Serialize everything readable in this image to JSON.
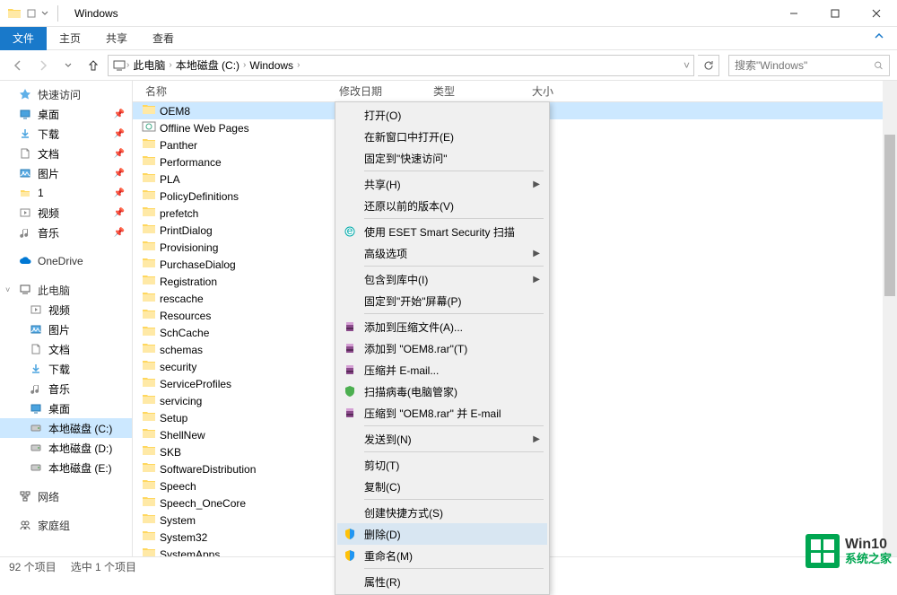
{
  "window": {
    "title": "Windows"
  },
  "ribbon": {
    "file": "文件",
    "home": "主页",
    "share": "共享",
    "view": "查看"
  },
  "breadcrumb": {
    "items": [
      "此电脑",
      "本地磁盘 (C:)",
      "Windows"
    ]
  },
  "search": {
    "placeholder": "搜索\"Windows\""
  },
  "sidebar": {
    "quick_access": "快速访问",
    "items1": [
      {
        "label": "桌面",
        "icon": "desktop"
      },
      {
        "label": "下载",
        "icon": "download"
      },
      {
        "label": "文档",
        "icon": "document"
      },
      {
        "label": "图片",
        "icon": "picture"
      },
      {
        "label": "1",
        "icon": "folder"
      },
      {
        "label": "视频",
        "icon": "video"
      },
      {
        "label": "音乐",
        "icon": "music"
      }
    ],
    "onedrive": "OneDrive",
    "this_pc": "此电脑",
    "items2": [
      {
        "label": "视频",
        "icon": "video"
      },
      {
        "label": "图片",
        "icon": "picture"
      },
      {
        "label": "文档",
        "icon": "document"
      },
      {
        "label": "下载",
        "icon": "download"
      },
      {
        "label": "音乐",
        "icon": "music"
      },
      {
        "label": "桌面",
        "icon": "desktop"
      },
      {
        "label": "本地磁盘 (C:)",
        "icon": "disk",
        "selected": true
      },
      {
        "label": "本地磁盘 (D:)",
        "icon": "disk"
      },
      {
        "label": "本地磁盘 (E:)",
        "icon": "disk"
      }
    ],
    "network": "网络",
    "homegroup": "家庭组"
  },
  "columns": {
    "name": "名称",
    "date": "修改日期",
    "type": "类型",
    "size": "大小"
  },
  "files": [
    {
      "name": "OEM8",
      "selected": true
    },
    {
      "name": "Offline Web Pages",
      "icon": "special"
    },
    {
      "name": "Panther"
    },
    {
      "name": "Performance"
    },
    {
      "name": "PLA"
    },
    {
      "name": "PolicyDefinitions"
    },
    {
      "name": "prefetch"
    },
    {
      "name": "PrintDialog"
    },
    {
      "name": "Provisioning"
    },
    {
      "name": "PurchaseDialog"
    },
    {
      "name": "Registration"
    },
    {
      "name": "rescache"
    },
    {
      "name": "Resources"
    },
    {
      "name": "SchCache"
    },
    {
      "name": "schemas"
    },
    {
      "name": "security"
    },
    {
      "name": "ServiceProfiles"
    },
    {
      "name": "servicing"
    },
    {
      "name": "Setup"
    },
    {
      "name": "ShellNew"
    },
    {
      "name": "SKB"
    },
    {
      "name": "SoftwareDistribution"
    },
    {
      "name": "Speech"
    },
    {
      "name": "Speech_OneCore"
    },
    {
      "name": "System"
    },
    {
      "name": "System32"
    },
    {
      "name": "SystemApps"
    }
  ],
  "context_menu": {
    "items": [
      {
        "label": "打开(O)",
        "type": "item"
      },
      {
        "label": "在新窗口中打开(E)",
        "type": "item"
      },
      {
        "label": "固定到\"快速访问\"",
        "type": "item"
      },
      {
        "type": "sep"
      },
      {
        "label": "共享(H)",
        "type": "submenu"
      },
      {
        "label": "还原以前的版本(V)",
        "type": "item"
      },
      {
        "type": "sep"
      },
      {
        "label": "使用 ESET Smart Security 扫描",
        "type": "item",
        "icon": "eset"
      },
      {
        "label": "高级选项",
        "type": "submenu"
      },
      {
        "type": "sep"
      },
      {
        "label": "包含到库中(I)",
        "type": "submenu"
      },
      {
        "label": "固定到\"开始\"屏幕(P)",
        "type": "item"
      },
      {
        "type": "sep"
      },
      {
        "label": "添加到压缩文件(A)...",
        "type": "item",
        "icon": "rar"
      },
      {
        "label": "添加到 \"OEM8.rar\"(T)",
        "type": "item",
        "icon": "rar"
      },
      {
        "label": "压缩并 E-mail...",
        "type": "item",
        "icon": "rar"
      },
      {
        "label": "扫描病毒(电脑管家)",
        "type": "item",
        "icon": "shieldg"
      },
      {
        "label": "压缩到 \"OEM8.rar\" 并 E-mail",
        "type": "item",
        "icon": "rar"
      },
      {
        "type": "sep"
      },
      {
        "label": "发送到(N)",
        "type": "submenu"
      },
      {
        "type": "sep"
      },
      {
        "label": "剪切(T)",
        "type": "item"
      },
      {
        "label": "复制(C)",
        "type": "item"
      },
      {
        "type": "sep"
      },
      {
        "label": "创建快捷方式(S)",
        "type": "item"
      },
      {
        "label": "删除(D)",
        "type": "item",
        "icon": "shield",
        "highlighted": true
      },
      {
        "label": "重命名(M)",
        "type": "item",
        "icon": "shield"
      },
      {
        "type": "sep"
      },
      {
        "label": "属性(R)",
        "type": "item"
      }
    ]
  },
  "status": {
    "count": "92 个项目",
    "selected": "选中 1 个项目"
  },
  "watermark": {
    "line1": "Win10",
    "line2": "系统之家"
  }
}
